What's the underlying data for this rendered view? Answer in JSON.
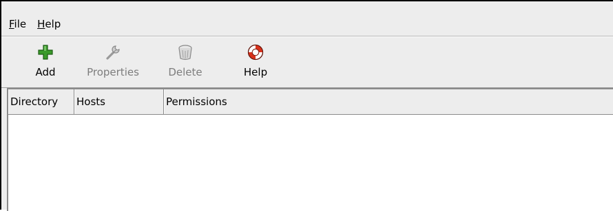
{
  "menubar": {
    "items": [
      {
        "mnemonic": "F",
        "rest": "ile"
      },
      {
        "mnemonic": "H",
        "rest": "elp"
      }
    ]
  },
  "toolbar": {
    "buttons": [
      {
        "label": "Add",
        "icon": "add-icon",
        "enabled": true
      },
      {
        "label": "Properties",
        "icon": "wrench-icon",
        "enabled": false
      },
      {
        "label": "Delete",
        "icon": "trash-icon",
        "enabled": false
      },
      {
        "label": "Help",
        "icon": "lifebuoy-icon",
        "enabled": true
      }
    ]
  },
  "table": {
    "columns": [
      "Directory",
      "Hosts",
      "Permissions"
    ],
    "rows": []
  },
  "colors": {
    "add_green": "#3a9a2a",
    "help_red": "#d8321c",
    "disabled_text": "#7d7d7d"
  }
}
